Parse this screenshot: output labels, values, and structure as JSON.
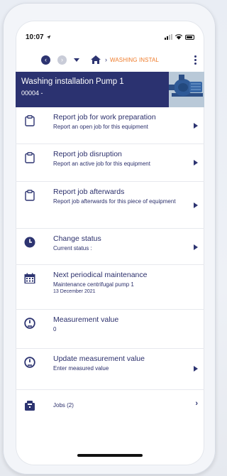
{
  "status_bar": {
    "time": "10:07"
  },
  "nav": {
    "breadcrumb": "WASHING INSTAL"
  },
  "equipment": {
    "title": "Washing installation Pump 1",
    "code": "00004 -"
  },
  "menu": [
    {
      "title": "Report job for work preparation",
      "subtitle": "Report an open job for this equipment",
      "icon": "clipboard-icon"
    },
    {
      "title": "Report job disruption",
      "subtitle": "Report an active job for this equipment",
      "icon": "clipboard-icon"
    },
    {
      "title": "Report job afterwards",
      "subtitle": "Report job afterwards for this piece of equipment",
      "icon": "clipboard-icon"
    },
    {
      "title": "Change status",
      "subtitle": "Current status :",
      "icon": "clock-icon"
    },
    {
      "title": "Next periodical maintenance",
      "subtitle": "Maintenance centrifugal pump 1",
      "detail": "13 December 2021",
      "icon": "calendar-icon"
    },
    {
      "title": "Measurement value",
      "subtitle": "0",
      "icon": "gauge-icon"
    },
    {
      "title": "Update measurement value",
      "subtitle": "Enter measured value",
      "icon": "gauge-icon"
    },
    {
      "title": "Jobs (2)",
      "icon": "jobs-icon"
    }
  ],
  "colors": {
    "primary": "#2b3270",
    "accent": "#ef7b2a"
  }
}
